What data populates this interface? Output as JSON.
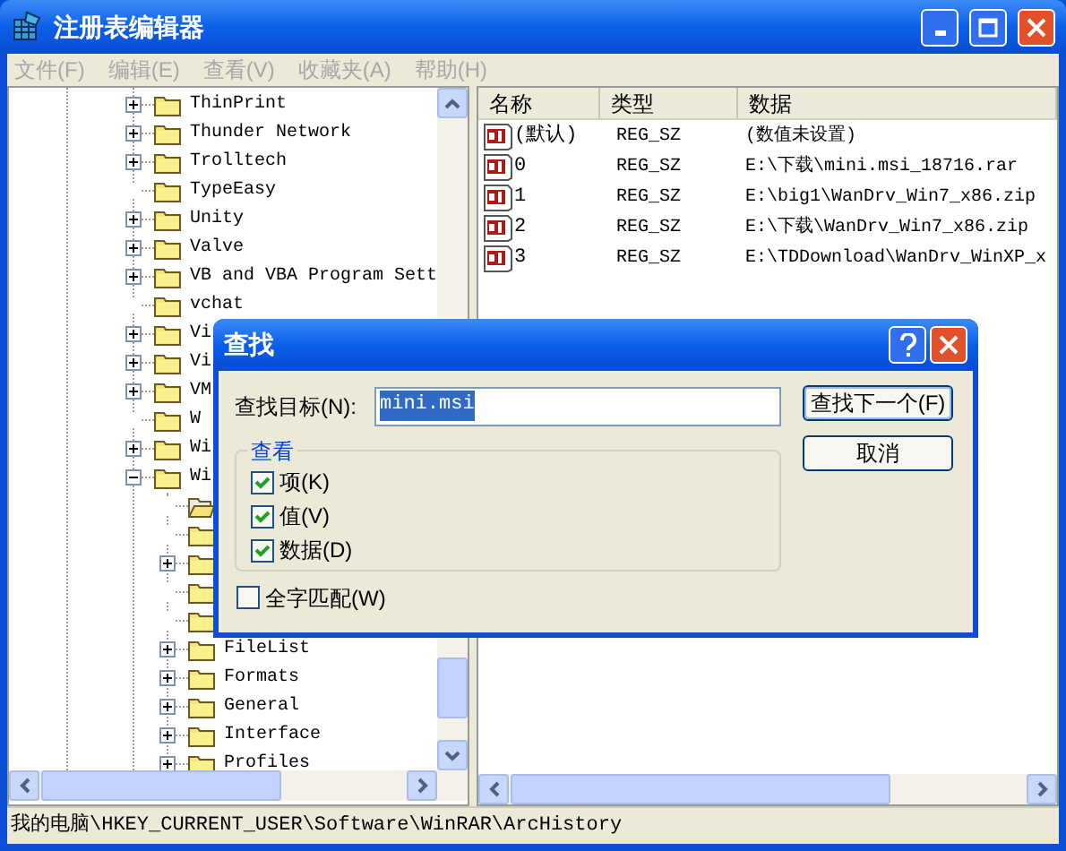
{
  "window": {
    "title": "注册表编辑器"
  },
  "menu": [
    {
      "label": "文件(F)",
      "disabled": true
    },
    {
      "label": "编辑(E)",
      "disabled": true
    },
    {
      "label": "查看(V)",
      "disabled": true
    },
    {
      "label": "收藏夹(A)",
      "disabled": true
    },
    {
      "label": "帮助(H)",
      "disabled": true
    }
  ],
  "tree": [
    {
      "label": "ThinPrint",
      "kind": "folder",
      "expanded": false
    },
    {
      "label": "Thunder Network",
      "kind": "folder",
      "expanded": false
    },
    {
      "label": "Trolltech",
      "kind": "folder",
      "expanded": false
    },
    {
      "label": "TypeEasy",
      "kind": "folder"
    },
    {
      "label": "Unity",
      "kind": "folder",
      "expanded": false
    },
    {
      "label": "Valve",
      "kind": "folder",
      "expanded": false
    },
    {
      "label": "VB and VBA Program Sett",
      "kind": "folder",
      "expanded": false
    },
    {
      "label": "vchat",
      "kind": "folder"
    },
    {
      "label": "Vi",
      "kind": "folder",
      "expanded": false
    },
    {
      "label": "Vi",
      "kind": "folder",
      "expanded": false
    },
    {
      "label": "VM",
      "kind": "folder",
      "expanded": false
    },
    {
      "label": "W",
      "kind": "folder"
    },
    {
      "label": "Wi",
      "kind": "folder",
      "expanded": false
    },
    {
      "label": "Wi",
      "kind": "folder",
      "expanded": true,
      "children": [
        {
          "kind": "open-folder"
        },
        {
          "kind": "folder"
        },
        {
          "kind": "folder",
          "expanded": false
        },
        {
          "kind": "folder"
        },
        {
          "kind": "folder"
        },
        {
          "label": "FileList",
          "kind": "folder",
          "expanded": false
        },
        {
          "label": "Formats",
          "kind": "folder",
          "expanded": false
        },
        {
          "label": "General",
          "kind": "folder",
          "expanded": false
        },
        {
          "label": "Interface",
          "kind": "folder",
          "expanded": false
        },
        {
          "label": "Profiles",
          "kind": "folder",
          "expanded": false
        }
      ]
    }
  ],
  "list": {
    "columns": [
      "名称",
      "类型",
      "数据"
    ],
    "rows": [
      {
        "name": "(默认)",
        "type": "REG_SZ",
        "data": "(数值未设置)"
      },
      {
        "name": "0",
        "type": "REG_SZ",
        "data": "E:\\下载\\mini.msi_18716.rar"
      },
      {
        "name": "1",
        "type": "REG_SZ",
        "data": "E:\\big1\\WanDrv_Win7_x86.zip"
      },
      {
        "name": "2",
        "type": "REG_SZ",
        "data": "E:\\下载\\WanDrv_Win7_x86.zip"
      },
      {
        "name": "3",
        "type": "REG_SZ",
        "data": "E:\\TDDownload\\WanDrv_WinXP_x"
      }
    ]
  },
  "status_bar": "我的电脑\\HKEY_CURRENT_USER\\Software\\WinRAR\\ArcHistory",
  "find_dialog": {
    "title": "查找",
    "target_label": "查找目标(N):",
    "target_value": "mini.msi",
    "find_next": "查找下一个(F)",
    "cancel": "取消",
    "look_in": {
      "title": "查看",
      "options": [
        {
          "label": "项(K)",
          "checked": true
        },
        {
          "label": "值(V)",
          "checked": true
        },
        {
          "label": "数据(D)",
          "checked": true
        }
      ]
    },
    "whole_word": {
      "label": "全字匹配(W)",
      "checked": false
    }
  }
}
